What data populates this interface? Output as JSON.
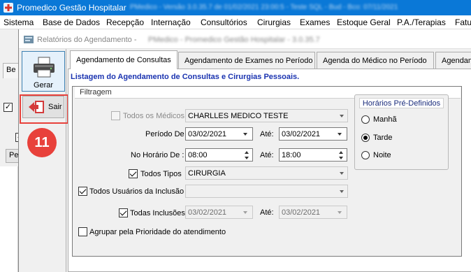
{
  "app": {
    "title": "Promedico Gestão Hospitalar",
    "title_obscured": "PMedico - Versão 3.0.35.7 de 01/02/2021 23:00:5 - Teste SQL - Bud - Bco: 07/11/2021"
  },
  "menu": [
    "Sistema",
    "Base de Dados",
    "Recepção",
    "Internação",
    "Consultórios",
    "Cirurgias",
    "Exames",
    "Estoque Geral",
    "P.A./Terapias",
    "Fatu"
  ],
  "background_window": {
    "tab_label": "Be",
    "button_label": "Pe"
  },
  "window": {
    "title": "Relatórios do Agendamento -",
    "title_obscured": "PMedico - Promedico Gestão Hospitalar - 3.0.35.7"
  },
  "toolbar": {
    "gerar_label": "Gerar",
    "sair_label": "Sair"
  },
  "annotation": {
    "step_number": "11",
    "highlight_color": "#e8413b"
  },
  "tabs": [
    {
      "label": "Agendamento de Consultas",
      "active": true
    },
    {
      "label": "Agendamento de Exames no Período",
      "active": false
    },
    {
      "label": "Agenda do Médico no Período",
      "active": false
    },
    {
      "label": "Agendam",
      "active": false
    }
  ],
  "panel": {
    "heading": "Listagem do Agendamento de Consultas e Cirurgias Pessoais."
  },
  "filtragem": {
    "title": "Filtragem",
    "todos_medicos": {
      "label": "Todos os Médicos",
      "checked": false,
      "enabled": false
    },
    "medico_value": "CHARLLES MEDICO TESTE",
    "periodo": {
      "label": "Período De :",
      "from": "03/02/2021",
      "ate_label": "Até:",
      "to": "03/02/2021"
    },
    "horario": {
      "label": "No Horário De :",
      "from": "08:00",
      "ate_label": "Até:",
      "to": "18:00"
    },
    "todos_tipos": {
      "label": "Todos Tipos",
      "checked": true
    },
    "tipo_value": "CIRURGIA",
    "todos_usuarios": {
      "label": "Todos Usuários da Inclusão",
      "checked": true
    },
    "usuario_value": "",
    "todas_inclusoes": {
      "label": "Todas Inclusões",
      "checked": true,
      "from": "03/02/2021",
      "ate_label": "Até:",
      "to": "03/02/2021"
    },
    "agrupar": {
      "label": "Agrupar pela Prioridade do atendimento",
      "checked": false
    },
    "horarios_predefinidos": {
      "title": "Horários Pré-Definidos",
      "options": [
        {
          "label": "Manhã",
          "selected": false
        },
        {
          "label": "Tarde",
          "selected": true
        },
        {
          "label": "Noite",
          "selected": false
        }
      ]
    }
  }
}
